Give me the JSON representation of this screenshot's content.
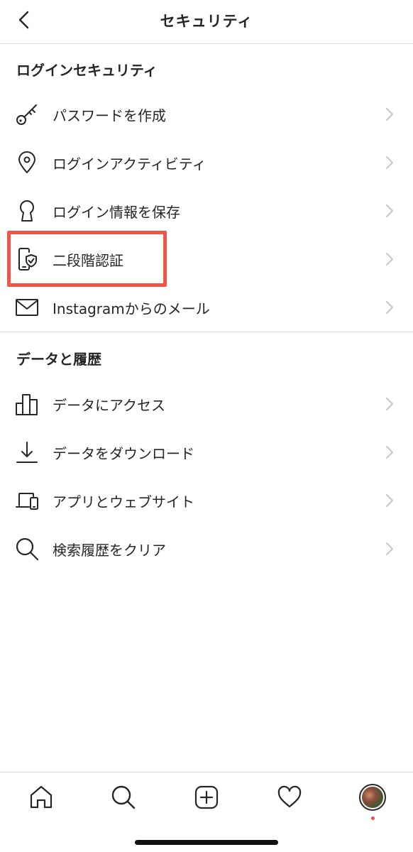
{
  "header": {
    "title": "セキュリティ",
    "back_icon": "chevron-left-icon"
  },
  "login_security": {
    "section_title": "ログインセキュリティ",
    "items": [
      {
        "label": "パスワードを作成",
        "icon": "key-icon"
      },
      {
        "label": "ログインアクティビティ",
        "icon": "location-pin-icon"
      },
      {
        "label": "ログイン情報を保存",
        "icon": "keyhole-icon"
      },
      {
        "label": "二段階認証",
        "icon": "phone-shield-icon",
        "highlighted": true
      },
      {
        "label": "Instagramからのメール",
        "icon": "mail-icon"
      }
    ]
  },
  "data_history": {
    "section_title": "データと履歴",
    "items": [
      {
        "label": "データにアクセス",
        "icon": "bar-chart-icon"
      },
      {
        "label": "データをダウンロード",
        "icon": "download-icon"
      },
      {
        "label": "アプリとウェブサイト",
        "icon": "devices-icon"
      },
      {
        "label": "検索履歴をクリア",
        "icon": "search-icon"
      }
    ]
  },
  "tabbar": {
    "tabs": [
      "home-icon",
      "search-icon",
      "new-post-icon",
      "activity-heart-icon",
      "profile-avatar"
    ],
    "notification_dot_color": "#ed4956"
  },
  "colors": {
    "text": "#262626",
    "divider": "#dbdbdb",
    "chevron": "#c7c7cc",
    "highlight": "#f0554a"
  }
}
